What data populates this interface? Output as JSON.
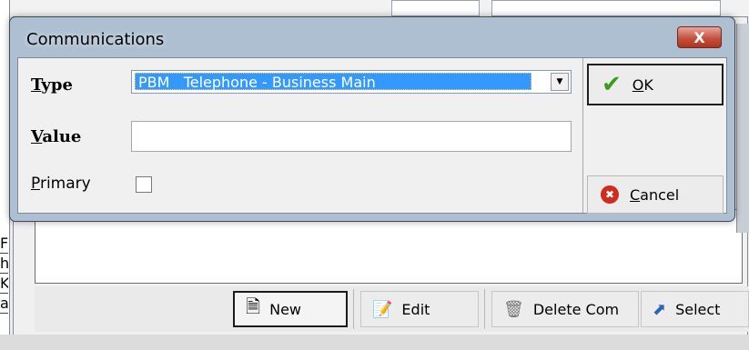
{
  "background": {
    "left_rows": [
      "Fr",
      "h",
      "K",
      "a"
    ],
    "toolbar": {
      "new_label": "New",
      "new_mnemonic": "w",
      "edit_label": "Edit",
      "delete_label": "Delete Com",
      "select_label": "Select"
    }
  },
  "dialog": {
    "title": "Communications",
    "close_label": "X",
    "type_label": "Type",
    "type_value": "PBM   Telephone - Business Main",
    "value_label": "Value",
    "value_text": "",
    "primary_label": "Primary",
    "primary_checked": false,
    "ok_label": "OK",
    "cancel_label": "Cancel"
  },
  "colors": {
    "selection": "#3399ff",
    "title_bar": "#aebfd2",
    "close_button": "#c4523e"
  }
}
